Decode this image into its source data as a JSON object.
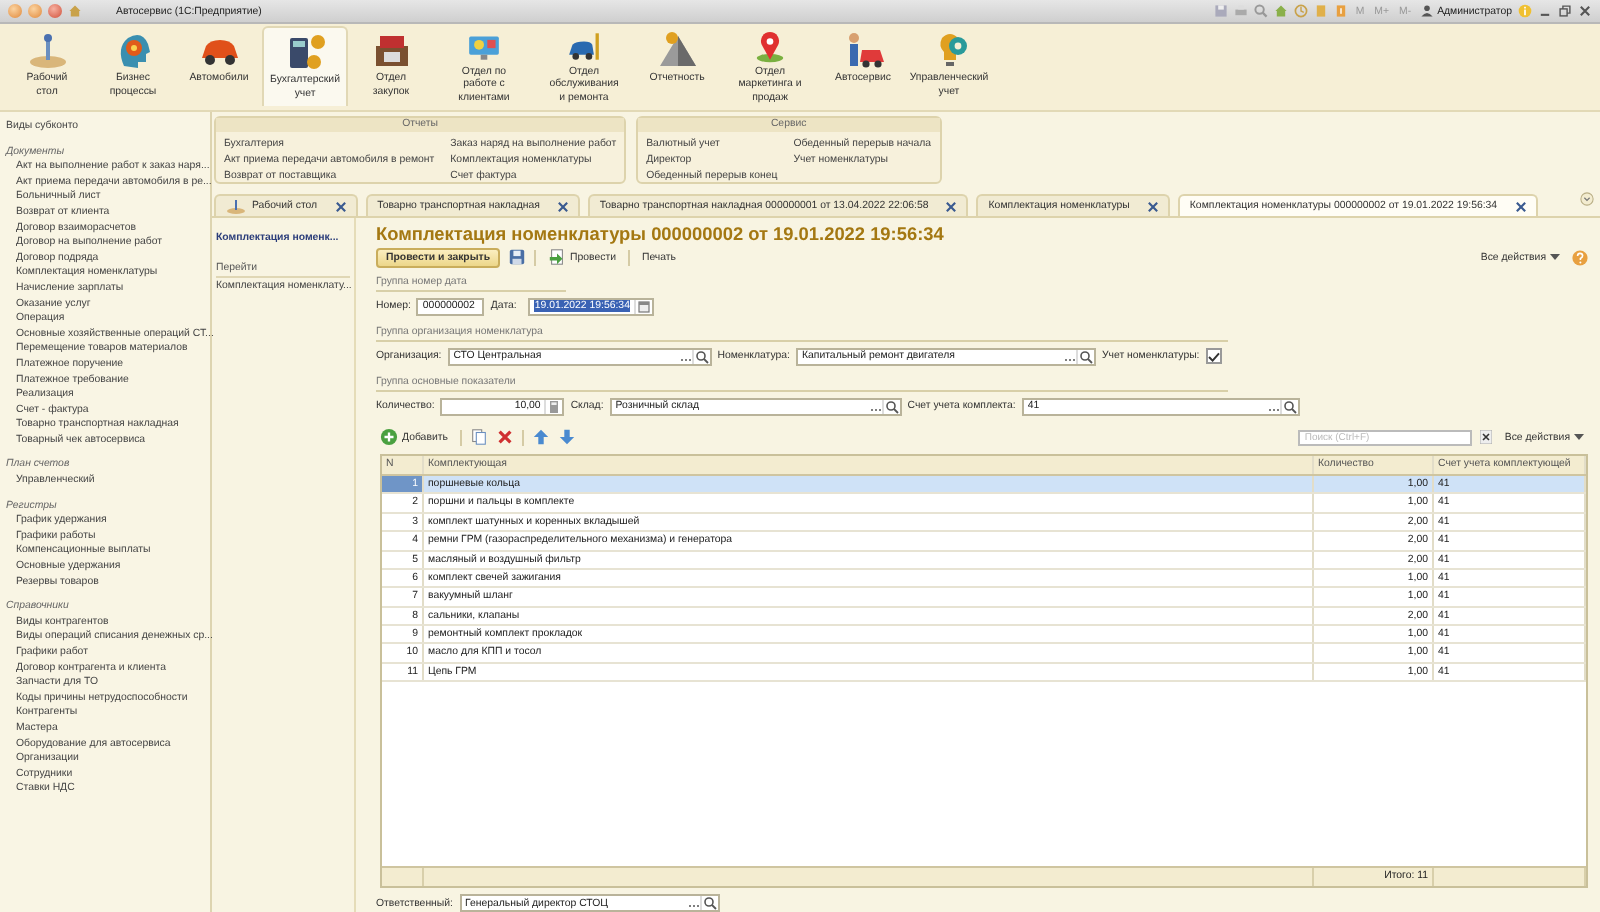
{
  "title_bar": {
    "title": "Автосервис (1С:Предприятие)",
    "memory_buttons": [
      "M",
      "M+",
      "M-"
    ],
    "user": "Администратор"
  },
  "sections": [
    {
      "label": "Рабочий стол",
      "selected": false
    },
    {
      "label": "Бизнес процессы",
      "selected": false
    },
    {
      "label": "Автомобили",
      "selected": false
    },
    {
      "label": "Бухгалтерский учет",
      "selected": true
    },
    {
      "label": "Отдел закупок",
      "selected": false
    },
    {
      "label": "Отдел по работе с клиентами",
      "selected": false
    },
    {
      "label": "Отдел обслуживания и ремонта",
      "selected": false
    },
    {
      "label": "Отчетность",
      "selected": false
    },
    {
      "label": "Отдел маркетинга и продаж",
      "selected": false
    },
    {
      "label": "Автосервис",
      "selected": false
    },
    {
      "label": "Управленческий учет",
      "selected": false
    }
  ],
  "sidebar": {
    "groups": [
      {
        "items": [
          "Виды субконто"
        ]
      },
      {
        "heading": "Документы",
        "items": [
          "Акт на выполнение работ к заказ наря...",
          "Акт приема передачи автомобиля в ре...",
          "Больничный лист",
          "Возврат от клиента",
          "Договор взаиморасчетов",
          "Договор на выполнение работ",
          "Договор подряда",
          "Комплектация номенклатуры",
          "Начисление зарплаты",
          "Оказание услуг",
          "Операция",
          "Основные хозяйственные операций СТ...",
          "Перемещение товаров материалов",
          "Платежное поручение",
          "Платежное требование",
          "Реализация",
          "Счет - фактура",
          "Товарно транспортная накладная",
          "Товарный чек автосервиса"
        ]
      },
      {
        "heading": "План счетов",
        "items": [
          "Управленческий"
        ]
      },
      {
        "heading": "Регистры",
        "items": [
          "График удержания",
          "Графики работы",
          "Компенсационные выплаты",
          "Основные удержания",
          "Резервы товаров"
        ]
      },
      {
        "heading": "Справочники",
        "items": [
          "Виды контрагентов",
          "Виды операций списания денежных ср...",
          "Графики работ",
          "Договор контрагента и клиента",
          "Запчасти для ТО",
          "Коды причины нетрудоспособности",
          "Контрагенты",
          "Мастера",
          "Оборудование для автосервиса",
          "Организации",
          "Сотрудники",
          "Ставки НДС"
        ]
      }
    ]
  },
  "submenu": {
    "panels": [
      {
        "title": "Отчеты",
        "columns": [
          [
            "Бухгалтерия",
            "Акт приема передачи автомобиля в ремонт",
            "Возврат от поставщика"
          ],
          [
            "Заказ наряд на выполнение работ",
            "Комплектация номенклатуры",
            "Счет фактура"
          ]
        ]
      },
      {
        "title": "Сервис",
        "columns": [
          [
            "Валютный учет",
            "Директор",
            "Обеденный перерыв конец"
          ],
          [
            "Обеденный перерыв начала",
            "Учет номенклатуры"
          ]
        ]
      }
    ]
  },
  "tabs": [
    {
      "label": "Рабочий стол",
      "selected": false,
      "kind": "desktop"
    },
    {
      "label": "Товарно транспортная накладная",
      "selected": false,
      "kind": "document"
    },
    {
      "label": "Товарно транспортная накладная 000000001 от 13.04.2022 22:06:58",
      "selected": false,
      "kind": "document"
    },
    {
      "label": "Комплектация номенклатуры",
      "selected": false,
      "kind": "document"
    },
    {
      "label": "Комплектация номенклатуры 000000002 от 19.01.2022 19:56:34",
      "selected": true,
      "kind": "document"
    }
  ],
  "nav_panel": {
    "current": "Комплектация номенк...",
    "heading": "Перейти",
    "links": [
      "Комплектация номенклату..."
    ]
  },
  "form": {
    "title": "Комплектация номенклатуры 000000002 от 19.01.2022 19:56:34",
    "commands": [
      {
        "label": "Провести и закрыть",
        "kind": "primary"
      },
      {
        "kind": "save"
      },
      {
        "label": "Провести",
        "kind": "post"
      },
      {
        "label": "Печать",
        "kind": "plain"
      }
    ],
    "all_actions": "Все действия",
    "groups": [
      {
        "title": "Группа номер дата",
        "fields": [
          {
            "label": "Номер:",
            "value": "000000002",
            "kind": "text"
          },
          {
            "label": "Дата:",
            "value": "19.01.2022 19:56:34",
            "kind": "date",
            "highlighted": true
          }
        ]
      },
      {
        "title": "Группа организация номенклатура",
        "fields": [
          {
            "label": "Организация:",
            "value": "СТО Центральная",
            "kind": "select"
          },
          {
            "label": "Номенклатура:",
            "value": "Капитальный ремонт двигателя",
            "kind": "select"
          },
          {
            "label": "Учет номенклатуры:",
            "kind": "checkbox",
            "checked": true
          }
        ]
      },
      {
        "title": "Группа основные показатели",
        "fields": [
          {
            "label": "Количество:",
            "value": "10,00",
            "kind": "number"
          },
          {
            "label": "Склад:",
            "value": "Розничный склад",
            "kind": "select"
          },
          {
            "label": "Счет учета комплекта:",
            "value": "41",
            "kind": "select"
          }
        ]
      }
    ],
    "table_toolbar": {
      "add": "Добавить",
      "search_placeholder": "Поиск (Ctrl+F)",
      "all_actions": "Все действия"
    },
    "table": {
      "columns": [
        "N",
        "Комплектующая",
        "Количество",
        "Счет учета комплектующей"
      ],
      "rows": [
        {
          "cells": [
            "1",
            "поршневые кольца",
            "1,00",
            "41"
          ],
          "selected": true
        },
        {
          "cells": [
            "2",
            "поршни и пальцы в комплекте",
            "1,00",
            "41"
          ],
          "selected": false
        },
        {
          "cells": [
            "3",
            "комплект шатунных и коренных вкладышей",
            "2,00",
            "41"
          ],
          "selected": false
        },
        {
          "cells": [
            "4",
            "ремни ГРМ (газораспределительного механизма) и генератора",
            "2,00",
            "41"
          ],
          "selected": false
        },
        {
          "cells": [
            "5",
            "масляный и воздушный фильтр",
            "2,00",
            "41"
          ],
          "selected": false
        },
        {
          "cells": [
            "6",
            "комплект свечей зажигания",
            "1,00",
            "41"
          ],
          "selected": false
        },
        {
          "cells": [
            "7",
            "вакуумный шланг",
            "1,00",
            "41"
          ],
          "selected": false
        },
        {
          "cells": [
            "8",
            "сальники, клапаны",
            "2,00",
            "41"
          ],
          "selected": false
        },
        {
          "cells": [
            "9",
            "ремонтный комплект прокладок",
            "1,00",
            "41"
          ],
          "selected": false
        },
        {
          "cells": [
            "10",
            "масло для КПП и тосол",
            "1,00",
            "41"
          ],
          "selected": false
        },
        {
          "cells": [
            "11",
            "Цепь ГРМ",
            "1,00",
            "41"
          ],
          "selected": false
        }
      ],
      "footer": "Итого: 11"
    },
    "responsible": {
      "label": "Ответственный:",
      "value": "Генеральный директор СТОЦ"
    }
  }
}
